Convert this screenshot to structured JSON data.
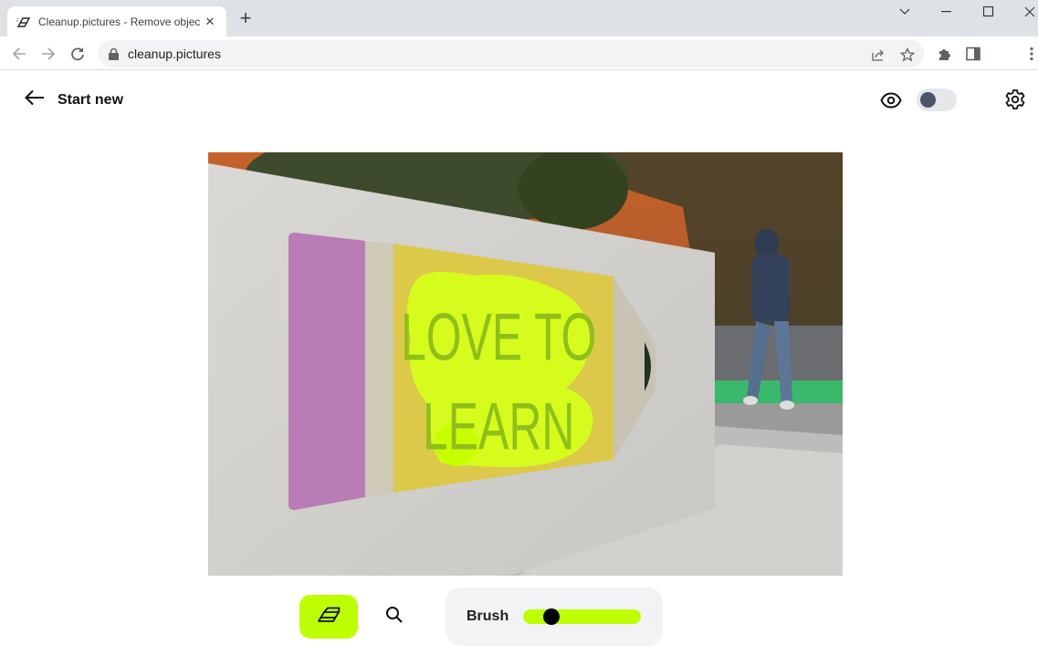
{
  "browser": {
    "tab": {
      "title": "Cleanup.pictures - Remove objec",
      "favicon": "eraser-favicon-icon",
      "close_icon": "close-icon"
    },
    "new_tab_icon": "plus-icon",
    "window_controls": [
      "chevron-down-icon",
      "minimize-icon",
      "maximize-icon",
      "close-icon"
    ],
    "nav": {
      "back": "arrow-left-icon",
      "forward": "arrow-right-icon",
      "reload": "reload-icon"
    },
    "address": {
      "url": "cleanup.pictures",
      "lock_icon": "lock-icon"
    },
    "address_actions": [
      "share-icon",
      "star-icon"
    ],
    "toolbar_icons": [
      "extensions-icon",
      "side-panel-icon",
      "more-vert-icon"
    ]
  },
  "app": {
    "header": {
      "start_new_label": "Start new",
      "back_icon": "arrow-left-icon",
      "preview_icon": "eye-icon",
      "compare_toggle": {
        "on": false
      },
      "settings_icon": "gear-icon"
    },
    "image": {
      "description": "Pencil-shaped sign reading LOVE TO LEARN on a white wall, person walking in background, text region masked with lime brush strokes",
      "sign_text_line1": "LOVE TO",
      "sign_text_line2": "LEARN"
    },
    "toolbar": {
      "eraser_icon": "eraser-icon",
      "zoom_icon": "search-icon",
      "brush_label": "Brush",
      "brush_size_fraction": 0.24
    },
    "colors": {
      "accent": "#bdff01",
      "toggle_track": "#e5e7eb",
      "toggle_knob": "#4b5567",
      "panel_bg": "#f2f3f5"
    }
  }
}
